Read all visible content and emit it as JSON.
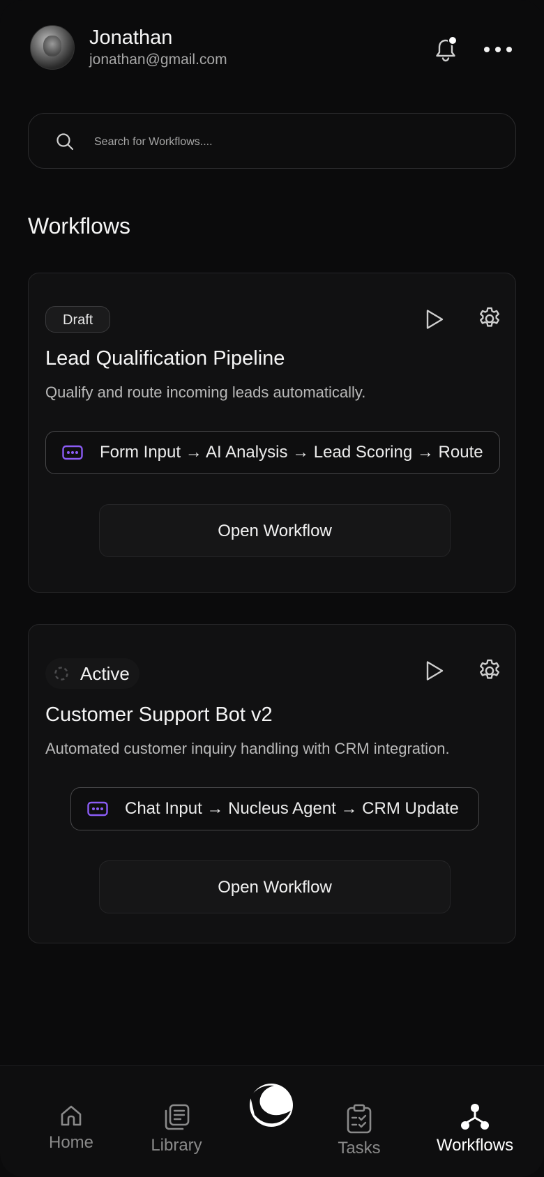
{
  "user": {
    "name": "Jonathan",
    "email": "jonathan@gmail.com"
  },
  "search": {
    "placeholder": "Search for Workflows...."
  },
  "section": {
    "title": "Workflows"
  },
  "workflows": [
    {
      "status": "Draft",
      "title": "Lead Qualification Pipeline",
      "description": "Qualify and route incoming leads automatically.",
      "flow": "Form Input → AI Analysis → Lead Scoring → Route",
      "button": "Open Workflow"
    },
    {
      "status": "Active",
      "title": "Customer Support Bot v2",
      "description": "Automated customer inquiry handling with CRM integration.",
      "flow": "Chat Input → Nucleus Agent → CRM Update",
      "button": "Open Workflow"
    }
  ],
  "nav": {
    "items": [
      {
        "label": "Home",
        "icon": "home-icon"
      },
      {
        "label": "Library",
        "icon": "library-icon"
      },
      {
        "label": "",
        "icon": "app-logo-icon"
      },
      {
        "label": "Tasks",
        "icon": "tasks-icon"
      },
      {
        "label": "Workflows",
        "icon": "workflows-icon",
        "active": true
      }
    ]
  },
  "colors": {
    "background": "#0b0b0c",
    "card": "#111112",
    "accent_purple": "#8b5cf6",
    "text_primary": "#f5f5f5",
    "text_secondary": "#b9b9b9"
  }
}
